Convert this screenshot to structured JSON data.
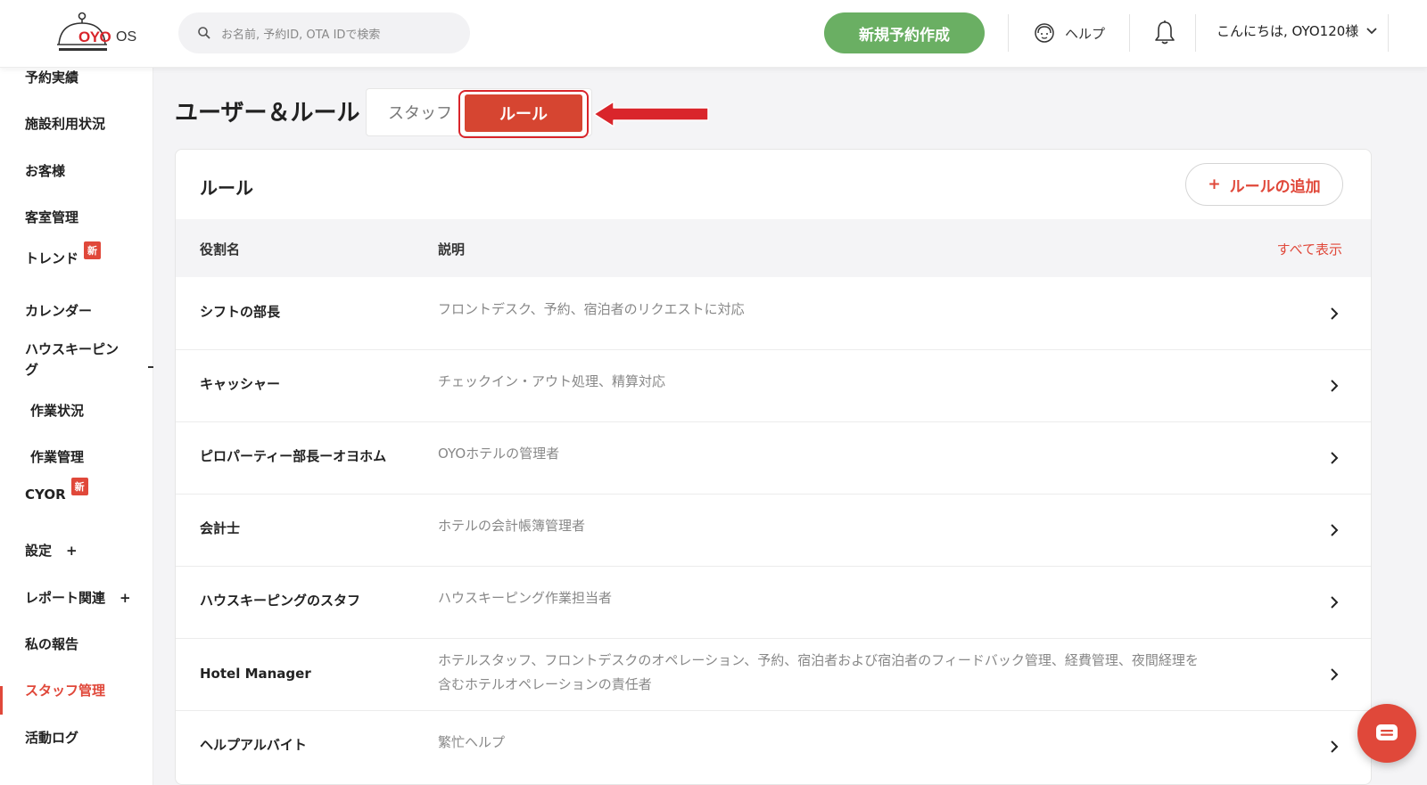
{
  "header": {
    "logo_text": "OYO",
    "logo_suffix": "OS",
    "search_placeholder": "お名前, 予約ID, OTA IDで検索",
    "new_booking_label": "新規予約作成",
    "help_label": "ヘルプ",
    "greeting": "こんにちは, OYO120様"
  },
  "sidebar": {
    "items": [
      {
        "label": "予約実績"
      },
      {
        "label": "施設利用状況"
      },
      {
        "label": "お客様"
      },
      {
        "label": "客室管理"
      },
      {
        "label": "トレンド",
        "badge": "新"
      },
      {
        "label": "カレンダー"
      },
      {
        "label": "ハウスキーピン"
      },
      {
        "label": "グ"
      },
      {
        "label": "作業状況"
      },
      {
        "label": "作業管理"
      },
      {
        "label": "CYOR",
        "badge": "新"
      },
      {
        "label": "設定",
        "suffix": "+"
      },
      {
        "label": "レポート関連",
        "suffix": "+"
      },
      {
        "label": "私の報告"
      },
      {
        "label": "スタッフ管理"
      },
      {
        "label": "活動ログ"
      }
    ]
  },
  "page": {
    "title": "ユーザー＆ルール",
    "tab_staff": "スタッフ",
    "tab_rule": "ルール"
  },
  "card": {
    "title": "ルール",
    "add_rule_label": "ルールの追加",
    "add_rule_plus": "+",
    "col_role": "役割名",
    "col_desc": "説明",
    "show_all": "すべて表示",
    "rows": [
      {
        "name": "シフトの部長",
        "desc": "フロントデスク、予約、宿泊者のリクエストに対応"
      },
      {
        "name": "キャッシャー",
        "desc": "チェックイン・アウト処理、精算対応"
      },
      {
        "name": "ピロパーティー部長ーオヨホム",
        "desc": "OYOホテルの管理者"
      },
      {
        "name": "会計士",
        "desc": "ホテルの会計帳簿管理者"
      },
      {
        "name": "ハウスキーピングのスタフ",
        "desc": "ハウスキーピング作業担当者"
      },
      {
        "name": "Hotel Manager",
        "desc": "ホテルスタッフ、フロントデスクのオペレーション、予約、宿泊者および宿泊者のフィードバック管理、経費管理、夜間経理を含むホテルオペレーションの責任者"
      },
      {
        "name": "ヘルプアルバイト",
        "desc": "繁忙ヘルプ"
      }
    ]
  },
  "colors": {
    "accent": "#e0483a",
    "primary_green": "#6aaf63"
  }
}
